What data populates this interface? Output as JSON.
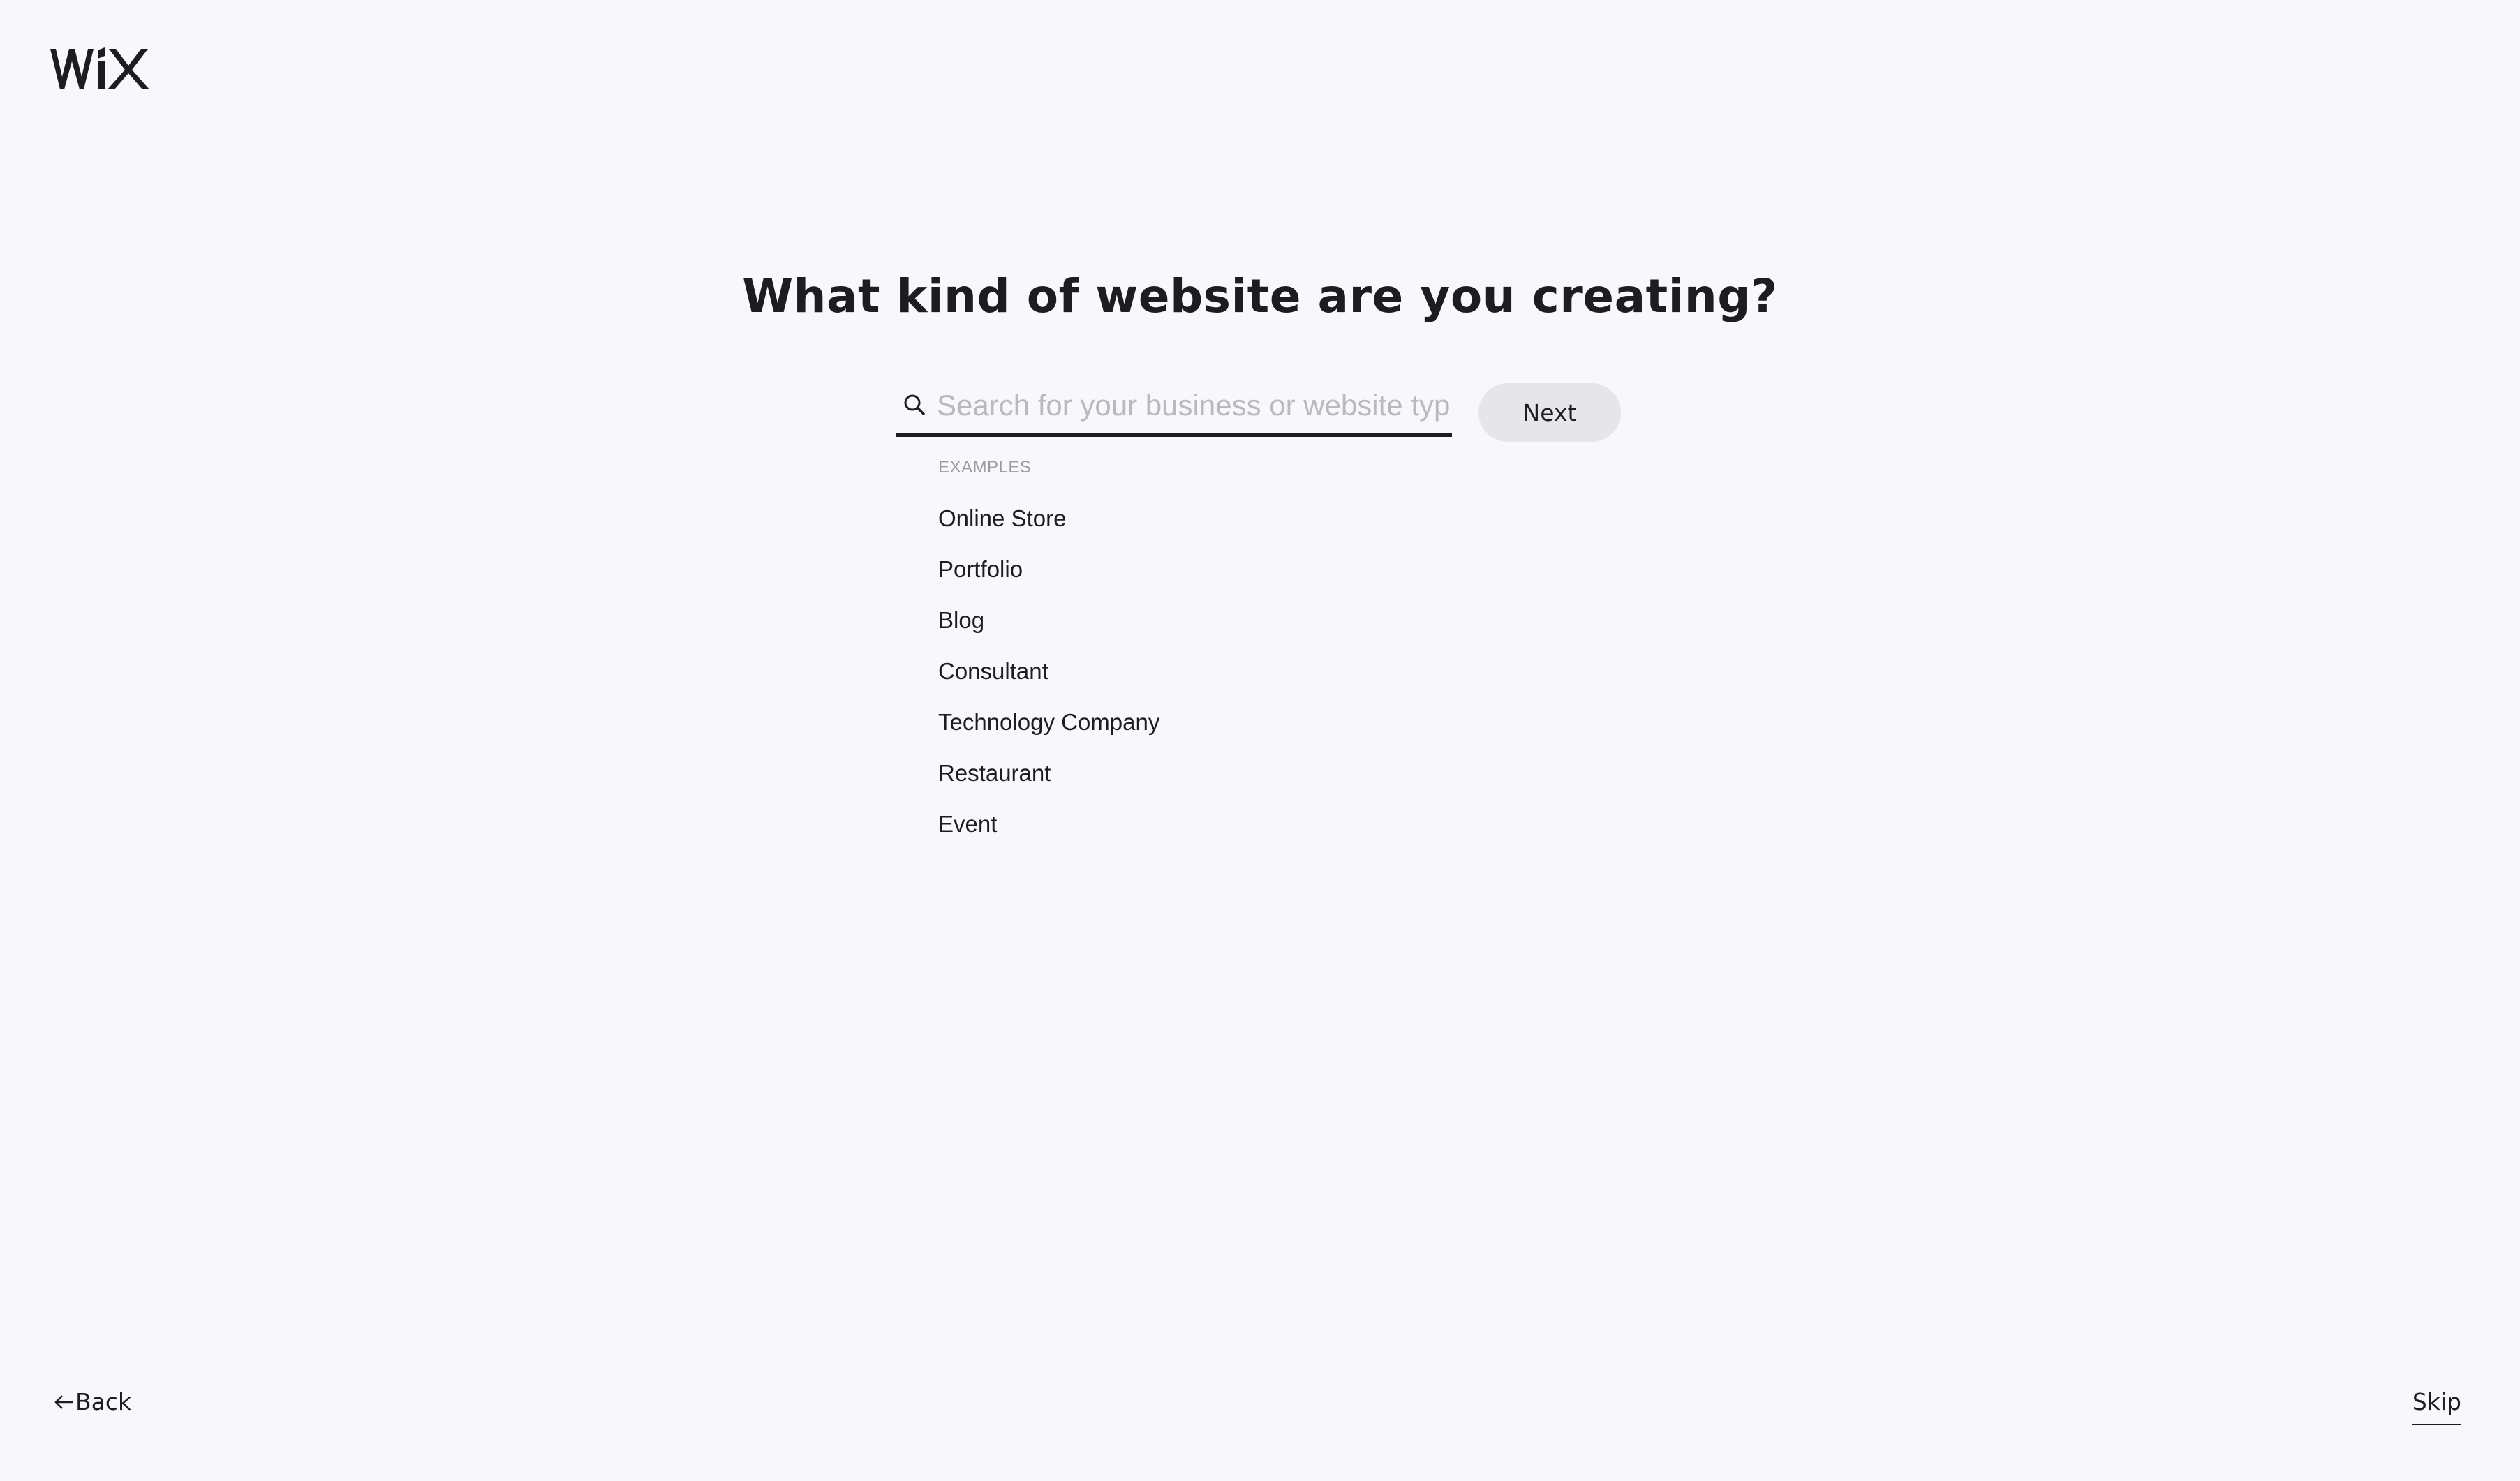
{
  "brand": {
    "logo_text": "WiX",
    "logo_icon": "wix-logo"
  },
  "page": {
    "title": "What kind of website are you creating?"
  },
  "search": {
    "icon": "search-icon",
    "placeholder": "Search for your business or website type",
    "value": ""
  },
  "next_button": {
    "label": "Next"
  },
  "examples": {
    "label": "EXAMPLES",
    "items": [
      "Online Store",
      "Portfolio",
      "Blog",
      "Consultant",
      "Technology Company",
      "Restaurant",
      "Event"
    ]
  },
  "footer": {
    "back_label": "Back",
    "back_icon": "arrow-left-icon",
    "skip_label": "Skip"
  },
  "colors": {
    "background": "#f8f8fa",
    "text": "#1c1d20",
    "placeholder": "#b9bac0",
    "muted": "#9a9ba1",
    "button_bg": "#e6e6ea"
  }
}
